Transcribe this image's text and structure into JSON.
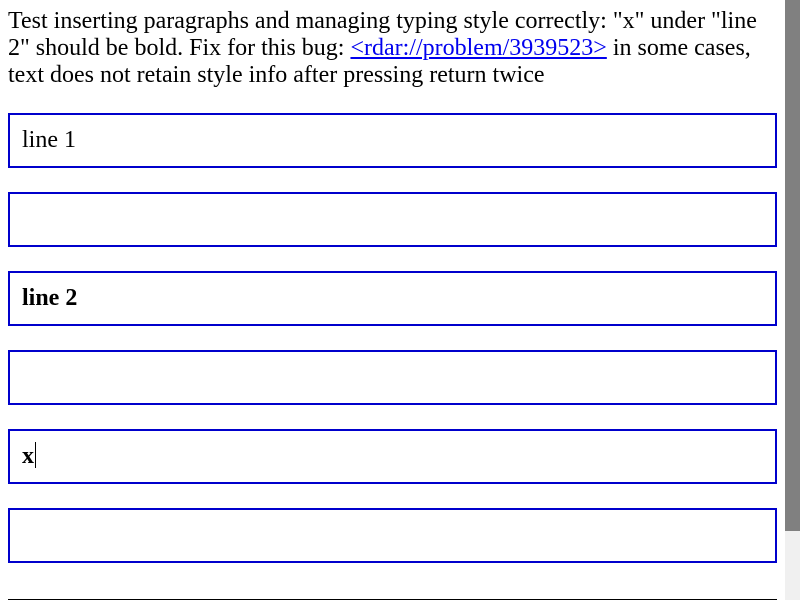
{
  "description": {
    "text_before": "Test inserting paragraphs and managing typing style correctly: \"x\" under \"line 2\" should be bold. Fix for this bug: ",
    "link_text": "<rdar://problem/3939523>",
    "text_after": " in some cases, text does not retain style info after pressing return twice"
  },
  "blocks": [
    {
      "text": "line 1",
      "bold": false
    },
    {
      "text": "",
      "bold": false
    },
    {
      "text": "line 2",
      "bold": true
    },
    {
      "text": "",
      "bold": false
    },
    {
      "text": "x",
      "bold": true,
      "has_caret": true
    },
    {
      "text": "",
      "bold": false
    }
  ],
  "colors": {
    "block_border": "#0000cc",
    "link": "#0000ee",
    "scrollbar_thumb": "#808080"
  }
}
